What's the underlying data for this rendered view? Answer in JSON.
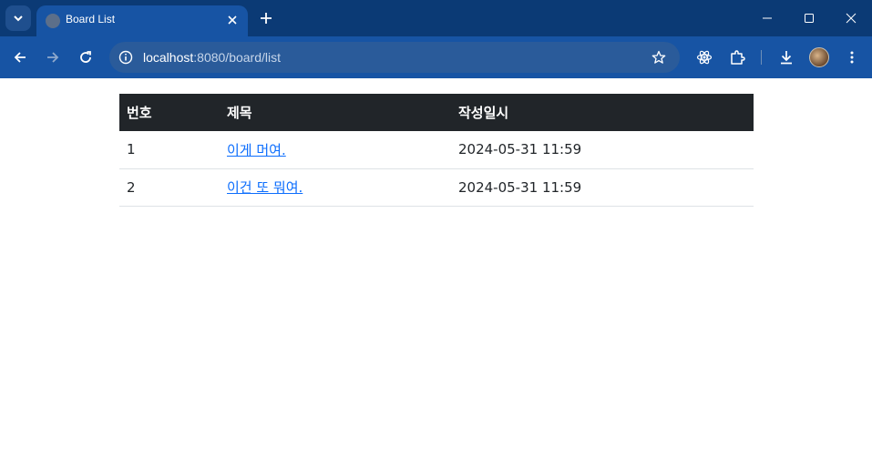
{
  "browser": {
    "tab_title": "Board List",
    "url_host": "localhost",
    "url_rest": ":8080/board/list"
  },
  "table": {
    "headers": [
      "번호",
      "제목",
      "작성일시"
    ],
    "rows": [
      {
        "no": "1",
        "title": "이게 머여.",
        "created_at": "2024-05-31 11:59"
      },
      {
        "no": "2",
        "title": "이건 또 뭐여.",
        "created_at": "2024-05-31 11:59"
      }
    ]
  },
  "colors": {
    "tab_strip": "#0b3a75",
    "toolbar": "#1754a4",
    "table_header_bg": "#212529",
    "link": "#0d6efd"
  },
  "icons": [
    "tab-search-icon",
    "globe-icon",
    "close-icon",
    "plus-icon",
    "minimize-icon",
    "maximize-icon",
    "window-close-icon",
    "back-arrow-icon",
    "forward-arrow-icon",
    "reload-icon",
    "info-icon",
    "star-icon",
    "react-devtools-icon",
    "extensions-puzzle-icon",
    "download-icon",
    "profile-avatar",
    "more-vert-icon"
  ]
}
